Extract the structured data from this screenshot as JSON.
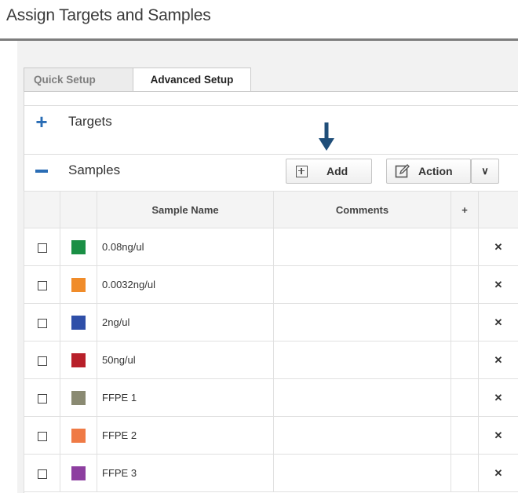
{
  "page": {
    "title": "Assign Targets and Samples"
  },
  "tabs": [
    {
      "label": "Quick Setup",
      "active": false
    },
    {
      "label": "Advanced Setup",
      "active": true
    }
  ],
  "targets_section": {
    "label": "Targets",
    "toggle": "+"
  },
  "samples_section": {
    "label": "Samples",
    "add_label": "Add",
    "action_label": "Action",
    "dropdown_glyph": "∨"
  },
  "grid": {
    "headers": {
      "sample_name": "Sample Name",
      "comments": "Comments",
      "plus": "+"
    },
    "rows": [
      {
        "name": "0.08ng/ul",
        "color": "#1a8f45",
        "comments": ""
      },
      {
        "name": "0.0032ng/ul",
        "color": "#f08c2a",
        "comments": ""
      },
      {
        "name": "2ng/ul",
        "color": "#2f4fa8",
        "comments": ""
      },
      {
        "name": "50ng/ul",
        "color": "#b8202a",
        "comments": ""
      },
      {
        "name": "FFPE 1",
        "color": "#8a8a72",
        "comments": ""
      },
      {
        "name": "FFPE 2",
        "color": "#ef7a45",
        "comments": ""
      },
      {
        "name": "FFPE 3",
        "color": "#8d3fa0",
        "comments": ""
      }
    ],
    "delete_glyph": "✕"
  },
  "colors": {
    "accent": "#2a6db5",
    "arrow": "#1f4e79"
  }
}
